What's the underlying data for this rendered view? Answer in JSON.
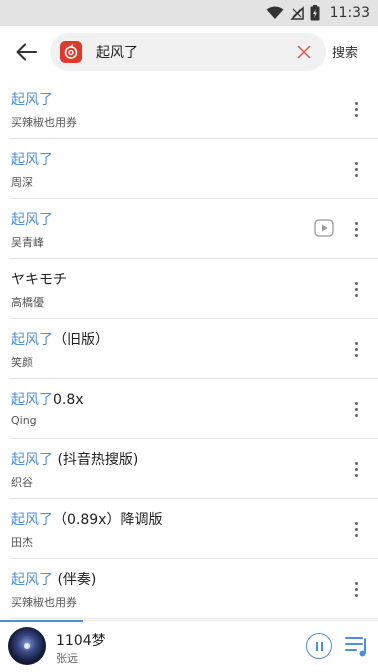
{
  "status_bar": {
    "time": "11:33"
  },
  "search": {
    "query": "起风了",
    "button_label": "搜索"
  },
  "songs": [
    {
      "title_hl": "起风了",
      "title_rest": "",
      "artist": "买辣椒也用券",
      "has_mv": false
    },
    {
      "title_hl": "起风了",
      "title_rest": "",
      "artist": "周深",
      "has_mv": false
    },
    {
      "title_hl": "起风了",
      "title_rest": "",
      "artist": "吴青峰",
      "has_mv": true
    },
    {
      "title_hl": "",
      "title_rest": "ヤキモチ",
      "artist": "高橋優",
      "has_mv": false
    },
    {
      "title_hl": "起风了",
      "title_rest": "（旧版）",
      "artist": "笑颜",
      "has_mv": false
    },
    {
      "title_hl": "起风了",
      "title_rest": "0.8x",
      "artist": "Qing",
      "has_mv": false
    },
    {
      "title_hl": "起风了",
      "title_rest": " (抖音热搜版)",
      "artist": "织谷",
      "has_mv": false
    },
    {
      "title_hl": "起风了",
      "title_rest": "（0.89x）降调版",
      "artist": "田杰",
      "has_mv": false
    },
    {
      "title_hl": "起风了",
      "title_rest": " (伴奏)",
      "artist": "买辣椒也用券",
      "has_mv": false
    }
  ],
  "now_playing": {
    "title": "1104梦",
    "artist": "张远",
    "progress": 0.22
  },
  "colors": {
    "accent": "#4f8fd6",
    "logo": "#dd3a2c",
    "clear": "#e0574a"
  },
  "icons": [
    "wifi-icon",
    "no-sim-icon",
    "battery-icon",
    "back-arrow-icon",
    "music-app-logo-icon",
    "clear-icon",
    "more-icon",
    "mv-play-icon",
    "pause-icon",
    "playlist-icon"
  ]
}
